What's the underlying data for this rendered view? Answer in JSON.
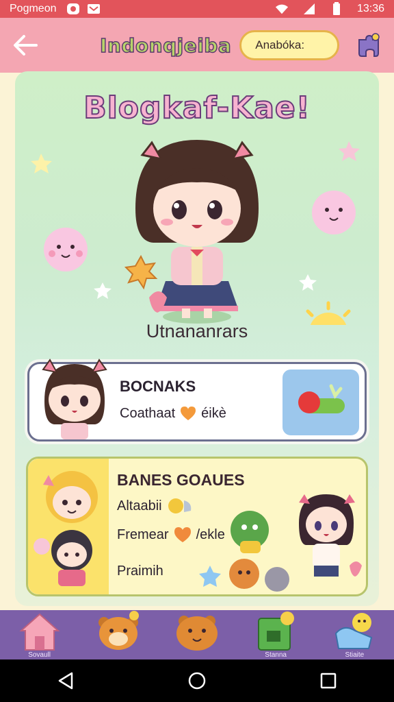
{
  "status_bar": {
    "app_name": "Pogmeon",
    "time": "13:36",
    "icons": [
      "notification-icon",
      "mail-icon",
      "wifi-icon",
      "signal-icon",
      "battery-icon"
    ]
  },
  "header": {
    "title": "Indonqjeiba",
    "search_value": "Anabóka:",
    "back_icon": "back-arrow-icon",
    "action_icon": "puzzle-icon"
  },
  "banner": {
    "title": "Blogkaf-Kae!",
    "character_name": "Utnananrars"
  },
  "card_one": {
    "title": "BOCNAKS",
    "subtitle": "Coathaat",
    "subtitle_suffix": "éikè"
  },
  "card_two": {
    "title": "BANES GOAUES",
    "rows": [
      {
        "label": "Altaabii"
      },
      {
        "label": "Fremear",
        "suffix": "/ekle"
      },
      {
        "label": "Praimih"
      }
    ]
  },
  "bottom_nav": {
    "items": [
      {
        "label": "Sovaull",
        "icon": "home-icon"
      },
      {
        "label": "",
        "icon": "bear-icon"
      },
      {
        "label": "",
        "icon": "cookie-icon"
      },
      {
        "label": "Stanna",
        "icon": "gift-icon"
      },
      {
        "label": "Stiaite",
        "icon": "shop-icon"
      }
    ]
  },
  "colors": {
    "status_bar": "#e2545b",
    "header": "#f4a6b2",
    "bottom_nav": "#7c5fa8",
    "panel": "#cdeccf"
  }
}
